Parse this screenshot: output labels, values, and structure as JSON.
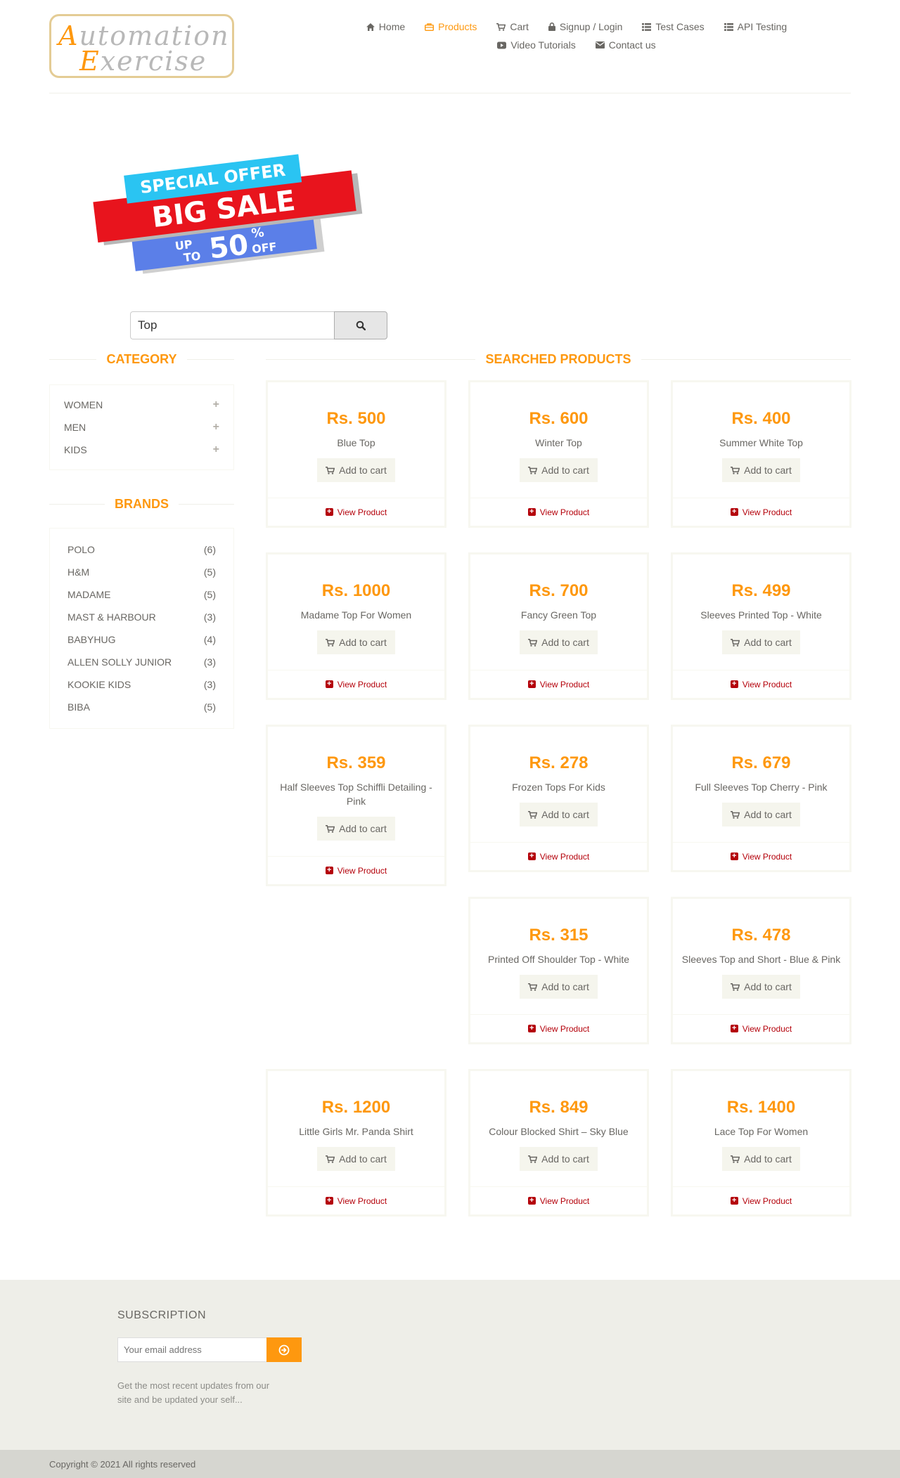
{
  "logo": {
    "line1_cap": "A",
    "line1_rest": "utomation",
    "line2_cap": "E",
    "line2_rest": "xercise"
  },
  "nav": {
    "row1": [
      {
        "icon": "home-icon",
        "label": "Home",
        "active": false
      },
      {
        "icon": "products-icon",
        "label": "Products",
        "active": true
      },
      {
        "icon": "cart-icon",
        "label": "Cart",
        "active": false
      },
      {
        "icon": "lock-icon",
        "label": "Signup / Login",
        "active": false
      },
      {
        "icon": "list-icon",
        "label": "Test Cases",
        "active": false
      },
      {
        "icon": "list-icon",
        "label": "API Testing",
        "active": false
      }
    ],
    "row2": [
      {
        "icon": "youtube-icon",
        "label": "Video Tutorials",
        "active": false
      },
      {
        "icon": "envelope-icon",
        "label": "Contact us",
        "active": false
      }
    ]
  },
  "banner": {
    "line1": "SPECIAL OFFER",
    "line2": "BIG SALE",
    "up": "UP",
    "to": "TO",
    "pct": "50",
    "pct_sign": "%",
    "off": "OFF"
  },
  "search": {
    "value": "Top"
  },
  "sidebar": {
    "category_title": "CATEGORY",
    "categories": [
      "WOMEN",
      "MEN",
      "KIDS"
    ],
    "brands_title": "BRANDS",
    "brands": [
      {
        "name": "POLO",
        "count": "(6)"
      },
      {
        "name": "H&M",
        "count": "(5)"
      },
      {
        "name": "MADAME",
        "count": "(5)"
      },
      {
        "name": "MAST & HARBOUR",
        "count": "(3)"
      },
      {
        "name": "BABYHUG",
        "count": "(4)"
      },
      {
        "name": "ALLEN SOLLY JUNIOR",
        "count": "(3)"
      },
      {
        "name": "KOOKIE KIDS",
        "count": "(3)"
      },
      {
        "name": "BIBA",
        "count": "(5)"
      }
    ]
  },
  "products_title": "SEARCHED PRODUCTS",
  "add_to_cart_label": "Add to cart",
  "view_product_label": "View Product",
  "products": [
    {
      "price": "Rs. 500",
      "name": "Blue Top"
    },
    {
      "price": "Rs. 600",
      "name": "Winter Top"
    },
    {
      "price": "Rs. 400",
      "name": "Summer White Top"
    },
    {
      "price": "Rs. 1000",
      "name": "Madame Top For Women"
    },
    {
      "price": "Rs. 700",
      "name": "Fancy Green Top"
    },
    {
      "price": "Rs. 499",
      "name": "Sleeves Printed Top - White"
    },
    {
      "price": "Rs. 359",
      "name": "Half Sleeves Top Schiffli Detailing - Pink"
    },
    {
      "price": "Rs. 278",
      "name": "Frozen Tops For Kids"
    },
    {
      "price": "Rs. 679",
      "name": "Full Sleeves Top Cherry - Pink"
    },
    {
      "price": "Rs. 315",
      "name": "Printed Off Shoulder Top - White"
    },
    {
      "price": "Rs. 478",
      "name": "Sleeves Top and Short - Blue & Pink"
    },
    {
      "price": "Rs. 1200",
      "name": "Little Girls Mr. Panda Shirt"
    },
    {
      "price": "Rs. 849",
      "name": "Colour Blocked Shirt – Sky Blue"
    },
    {
      "price": "Rs. 1400",
      "name": "Lace Top For Women"
    }
  ],
  "footer": {
    "subscription_title": "SUBSCRIPTION",
    "email_placeholder": "Your email address",
    "sub_text": "Get the most recent updates from our site and be updated your self...",
    "copyright": "Copyright © 2021 All rights reserved"
  },
  "colors": {
    "accent": "#fe980f",
    "link_red": "#b4000a",
    "footer_bg": "#eeeee8"
  }
}
